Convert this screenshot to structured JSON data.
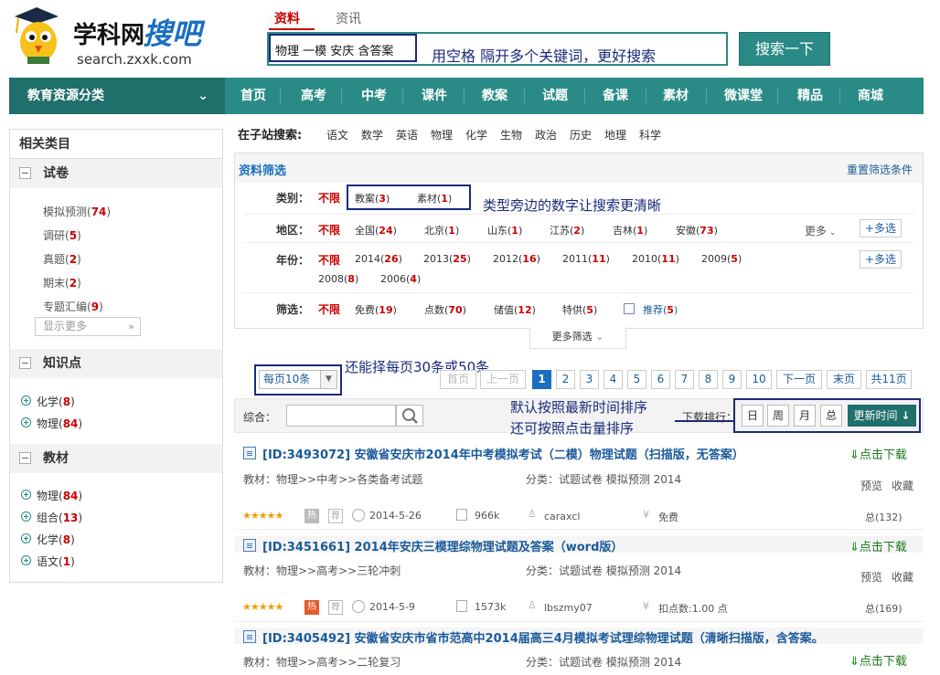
{
  "logo": {
    "name": "学科网",
    "brand": "搜吧",
    "domain": "search.zxxk.com"
  },
  "search": {
    "tabs": [
      "资料",
      "资讯"
    ],
    "value": "物理 一模 安庆 含答案",
    "hint": "用空格 隔开多个关键词，更好搜索",
    "button": "搜索一下"
  },
  "nav": {
    "category": "教育资源分类",
    "items": [
      "首页",
      "高考",
      "中考",
      "课件",
      "教案",
      "试题",
      "备课",
      "素材",
      "微课堂",
      "精品",
      "商城"
    ]
  },
  "sidebar": {
    "title": "相关类目",
    "groups": [
      {
        "label": "试卷",
        "items": [
          {
            "label": "模拟预测",
            "count": "74"
          },
          {
            "label": "调研",
            "count": "5"
          },
          {
            "label": "真题",
            "count": "2"
          },
          {
            "label": "期末",
            "count": "2"
          },
          {
            "label": "专题汇编",
            "count": "9"
          }
        ],
        "more": "显示更多"
      },
      {
        "label": "知识点",
        "items": [
          {
            "label": "化学",
            "count": "8"
          },
          {
            "label": "物理",
            "count": "84"
          }
        ]
      },
      {
        "label": "教材",
        "items": [
          {
            "label": "物理",
            "count": "84"
          },
          {
            "label": "组合",
            "count": "13"
          },
          {
            "label": "化学",
            "count": "8"
          },
          {
            "label": "语文",
            "count": "1"
          }
        ]
      }
    ]
  },
  "subsite": {
    "label": "在子站搜索:",
    "items": [
      "语文",
      "数学",
      "英语",
      "物理",
      "化学",
      "生物",
      "政治",
      "历史",
      "地理",
      "科学"
    ]
  },
  "filter": {
    "title": "资料筛选",
    "reset": "重置筛选条件",
    "none": "不限",
    "more": "更多",
    "multi": "+多选",
    "type": {
      "label": "类别：",
      "options": [
        {
          "label": "教案",
          "count": "3"
        },
        {
          "label": "素材",
          "count": "1"
        }
      ]
    },
    "region": {
      "label": "地区：",
      "options": [
        {
          "label": "全国",
          "count": "24"
        },
        {
          "label": "北京",
          "count": "1"
        },
        {
          "label": "山东",
          "count": "1"
        },
        {
          "label": "江苏",
          "count": "2"
        },
        {
          "label": "吉林",
          "count": "1"
        },
        {
          "label": "安徽",
          "count": "73"
        }
      ]
    },
    "year": {
      "label": "年份：",
      "options": [
        {
          "label": "2014",
          "count": "26"
        },
        {
          "label": "2013",
          "count": "25"
        },
        {
          "label": "2012",
          "count": "16"
        },
        {
          "label": "2011",
          "count": "11"
        },
        {
          "label": "2010",
          "count": "11"
        },
        {
          "label": "2009",
          "count": "5"
        },
        {
          "label": "2008",
          "count": "8"
        },
        {
          "label": "2006",
          "count": "4"
        }
      ]
    },
    "screen": {
      "label": "筛选：",
      "options": [
        {
          "label": "免费",
          "count": "19"
        },
        {
          "label": "点数",
          "count": "70"
        },
        {
          "label": "储值",
          "count": "12"
        },
        {
          "label": "特供",
          "count": "5"
        },
        {
          "label": "推荐",
          "count": "5"
        }
      ]
    },
    "type_hint": "类型旁边的数字让搜索更清晰",
    "more_filter": "更多筛选"
  },
  "pager": {
    "per_page": "每页10条",
    "hint": "还能择每页30条或50条",
    "first": "首页",
    "prev": "上一页",
    "pages": [
      "1",
      "2",
      "3",
      "4",
      "5",
      "6",
      "7",
      "8",
      "9",
      "10"
    ],
    "next": "下一页",
    "last": "末页",
    "total": "共11页"
  },
  "sort": {
    "label": "综合：",
    "sort_label": "下载排行：",
    "buttons": [
      "日",
      "周",
      "月",
      "总"
    ],
    "latest": "更新时间",
    "hint1": "默认按照最新时间排序",
    "hint2": "还可按照点击量排序"
  },
  "results": [
    {
      "title": "[ID:3493072] 安徽省安庆市2014年中考模拟考试（二模）物理试题（扫描版，无答案）",
      "download": "点击下载",
      "material": "教材：物理>>中考>>各类备考试题",
      "category": "分类：试题试卷 模拟预测 2014",
      "preview": "预览",
      "fav": "收藏",
      "date": "2014-5-26",
      "size": "966k",
      "user": "caraxcl",
      "price": "免费",
      "total": "总(132)",
      "hot": "热",
      "rec": "荐"
    },
    {
      "title": "[ID:3451661] 2014年安庆三模理综物理试题及答案（word版）",
      "download": "点击下载",
      "material": "教材：物理>>高考>>三轮冲刺",
      "category": "分类：试题试卷 模拟预测 2014",
      "preview": "预览",
      "fav": "收藏",
      "date": "2014-5-9",
      "size": "1573k",
      "user": "lbszmy07",
      "price": "扣点数:1.00 点",
      "total": "总(169)",
      "hot": "热",
      "rec": "荐"
    },
    {
      "title": "[ID:3405492] 安徽省安庆市省市范高中2014届高三4月模拟考试理综物理试题（清晰扫描版，含答案。",
      "download": "点击下载",
      "material": "教材：物理>>高考>>二轮复习",
      "category": "分类：试题试卷 模拟预测 2014"
    }
  ],
  "colors": {
    "primary": "#2a8b86",
    "accent_red": "#cc0000",
    "annotation": "#1b2a7a",
    "link": "#1a5a9a"
  }
}
